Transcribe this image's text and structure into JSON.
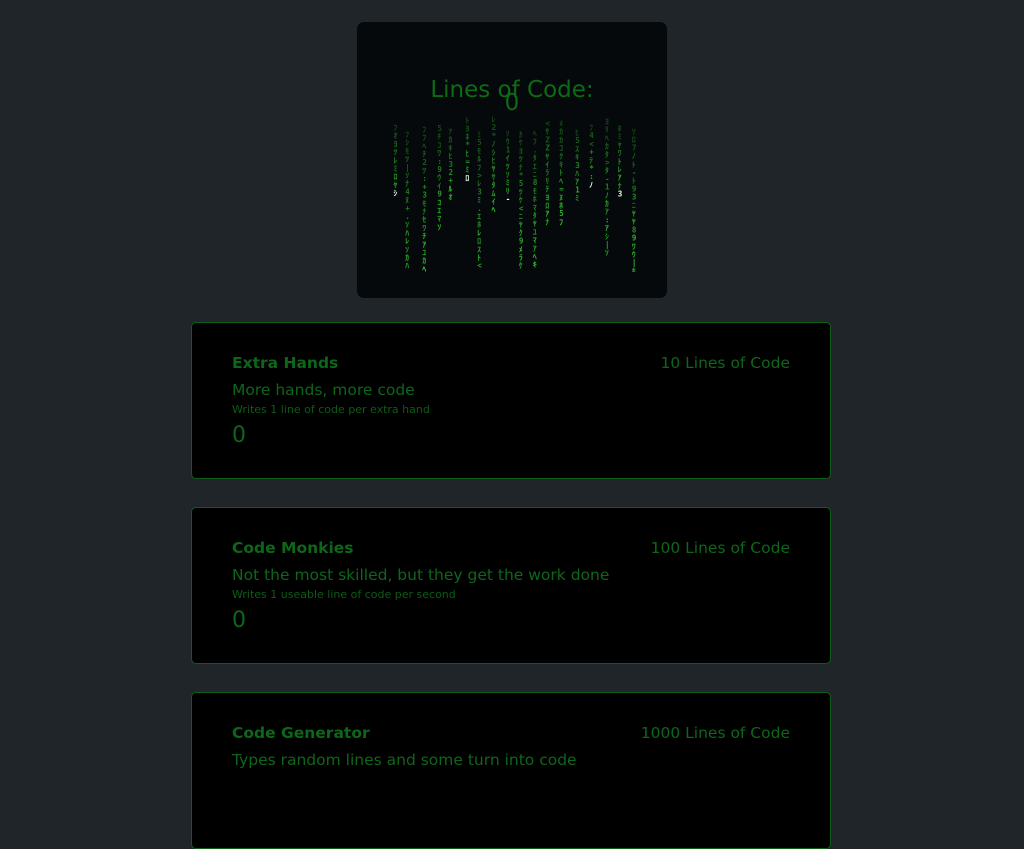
{
  "counter": {
    "title": "Lines of Code:",
    "value": "0"
  },
  "upgrades": [
    {
      "name": "Extra Hands",
      "cost": "10 Lines of Code",
      "tagline": "More hands, more code",
      "description": "Writes 1 line of code per extra hand",
      "owned": "0"
    },
    {
      "name": "Code Monkies",
      "cost": "100 Lines of Code",
      "tagline": "Not the most skilled, but they get the work done",
      "description": "Writes 1 useable line of code per second",
      "owned": "0"
    },
    {
      "name": "Code Generator",
      "cost": "1000 Lines of Code",
      "tagline": "Types random lines and some turn into code",
      "description": "",
      "owned": ""
    }
  ],
  "colors": {
    "page_background": "#1f2528",
    "panel_background": "#06090b",
    "card_background": "#000000",
    "card_border": "#0d5d14",
    "text_green": "#0e661a",
    "rain_bright": "#3cff3c",
    "rain_head": "#e6ffe6"
  }
}
